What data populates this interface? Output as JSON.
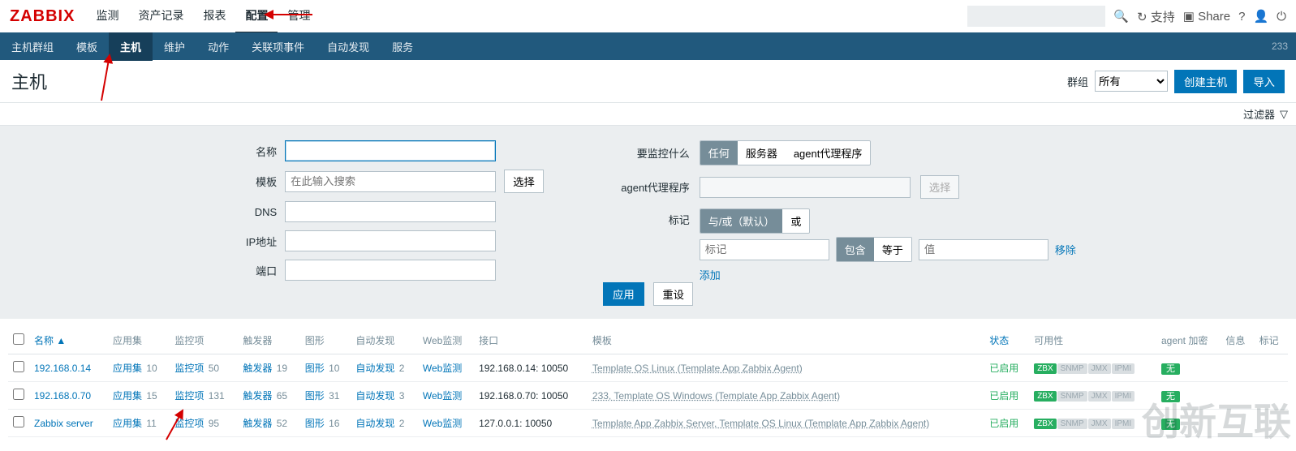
{
  "logo": "ZABBIX",
  "topnav": {
    "items": [
      "监测",
      "资产记录",
      "报表",
      "配置",
      "管理"
    ],
    "selected_index": 3
  },
  "topnav_right": {
    "support": "支持",
    "share": "Share"
  },
  "search_top_placeholder": "",
  "subnav": {
    "items": [
      "主机群组",
      "模板",
      "主机",
      "维护",
      "动作",
      "关联项事件",
      "自动发现",
      "服务"
    ],
    "selected_index": 2,
    "tip": "233"
  },
  "page_title": "主机",
  "group_label": "群组",
  "group_value": "所有",
  "btn_create_host": "创建主机",
  "btn_import": "导入",
  "filter_toggle": "过滤器",
  "filter": {
    "name_label": "名称",
    "tpl_label": "模板",
    "tpl_placeholder": "在此输入搜索",
    "tpl_select_btn": "选择",
    "dns_label": "DNS",
    "ip_label": "IP地址",
    "port_label": "端口",
    "monitor_label": "要监控什么",
    "monitor_opts": [
      "任何",
      "服务器",
      "agent代理程序"
    ],
    "monitor_active": 0,
    "agent_proxy_label": "agent代理程序",
    "agent_proxy_select": "选择",
    "tags_label": "标记",
    "tags_mode_opts": [
      "与/或（默认）",
      "或"
    ],
    "tags_mode_active": 0,
    "tag_key_ph": "标记",
    "tag_match_opts": [
      "包含",
      "等于"
    ],
    "tag_match_active": 0,
    "tag_val_ph": "值",
    "tag_remove": "移除",
    "tag_add": "添加",
    "apply": "应用",
    "reset": "重设"
  },
  "table": {
    "headers": {
      "name": "名称",
      "apps": "应用集",
      "items": "监控项",
      "triggers": "触发器",
      "graphs": "图形",
      "discovery": "自动发现",
      "web": "Web监测",
      "iface": "接口",
      "templates": "模板",
      "status": "状态",
      "availability": "可用性",
      "agent_enc": "agent 加密",
      "info": "信息",
      "tags": "标记"
    },
    "rows": [
      {
        "name": "192.168.0.14",
        "apps": 10,
        "items": 50,
        "triggers": 19,
        "graphs": 10,
        "discovery": 2,
        "web": "Web监测",
        "iface": "192.168.0.14: 10050",
        "templates": "Template OS Linux (Template App Zabbix Agent)",
        "status": "已启用",
        "avail": {
          "zbx": true
        },
        "enc": "无"
      },
      {
        "name": "192.168.0.70",
        "apps": 15,
        "items": 131,
        "triggers": 65,
        "graphs": 31,
        "discovery": 3,
        "web": "Web监测",
        "iface": "192.168.0.70: 10050",
        "templates": "233, Template OS Windows (Template App Zabbix Agent)",
        "status": "已启用",
        "avail": {
          "zbx": true
        },
        "enc": "无"
      },
      {
        "name": "Zabbix server",
        "apps": 11,
        "items": 95,
        "triggers": 52,
        "graphs": 16,
        "discovery": 2,
        "web": "Web监测",
        "iface": "127.0.0.1: 10050",
        "templates": "Template App Zabbix Server, Template OS Linux (Template App Zabbix Agent)",
        "status": "已启用",
        "avail": {
          "zbx": true
        },
        "enc": "无"
      }
    ],
    "cell_labels": {
      "apps": "应用集",
      "items": "监控项",
      "triggers": "触发器",
      "graphs": "图形",
      "discovery": "自动发现"
    }
  },
  "watermark": "创新互联"
}
